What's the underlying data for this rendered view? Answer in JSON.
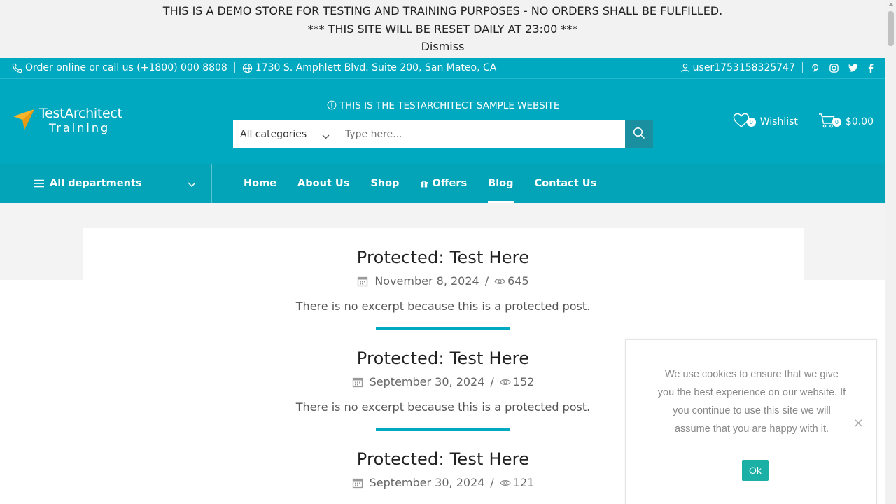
{
  "demo_banner": {
    "line1": "THIS IS A DEMO STORE FOR TESTING AND TRAINING PURPOSES - NO ORDERS SHALL BE FULFILLED.",
    "line2": "*** THIS SITE WILL BE RESET DAILY AT 23:00 ***",
    "dismiss": "Dismiss"
  },
  "topbar": {
    "phone": "Order online or call us (+1800) 000 8808",
    "address": "1730 S. Amphlett Blvd. Suite 200, San Mateo, CA",
    "user": "user1753158325747",
    "social_icons": [
      "pinterest-icon",
      "instagram-icon",
      "twitter-icon",
      "facebook-icon"
    ]
  },
  "header": {
    "logo_line1": "TestArchitect",
    "logo_line2": "Training",
    "notice": "THIS IS THE TESTARCHITECT SAMPLE WEBSITE",
    "search_category": "All categories",
    "search_placeholder": "Type here...",
    "wishlist_count": "0",
    "wishlist_label": "Wishlist",
    "cart_count": "0",
    "cart_total": "$0.00"
  },
  "nav": {
    "departments": "All departments",
    "items": [
      {
        "label": "Home"
      },
      {
        "label": "About Us"
      },
      {
        "label": "Shop"
      },
      {
        "label": "Offers"
      },
      {
        "label": "Blog"
      },
      {
        "label": "Contact Us"
      }
    ],
    "active": "Blog"
  },
  "posts": [
    {
      "title": "Protected: Test Here",
      "date": "November 8, 2024",
      "views": "645",
      "excerpt": "There is no excerpt because this is a protected post."
    },
    {
      "title": "Protected: Test Here",
      "date": "September 30, 2024",
      "views": "152",
      "excerpt": "There is no excerpt because this is a protected post."
    },
    {
      "title": "Protected: Test Here",
      "date": "September 30, 2024",
      "views": "121"
    }
  ],
  "cookie": {
    "message": "We use cookies to ensure that we give you the best experience on our website. If you continue to use this site we will assume that you are happy with it.",
    "ok": "Ok",
    "close": "×"
  },
  "colors": {
    "brand": "#00a9c0",
    "nav": "#03a3b8",
    "cookie_ok": "#1ab0a6"
  }
}
